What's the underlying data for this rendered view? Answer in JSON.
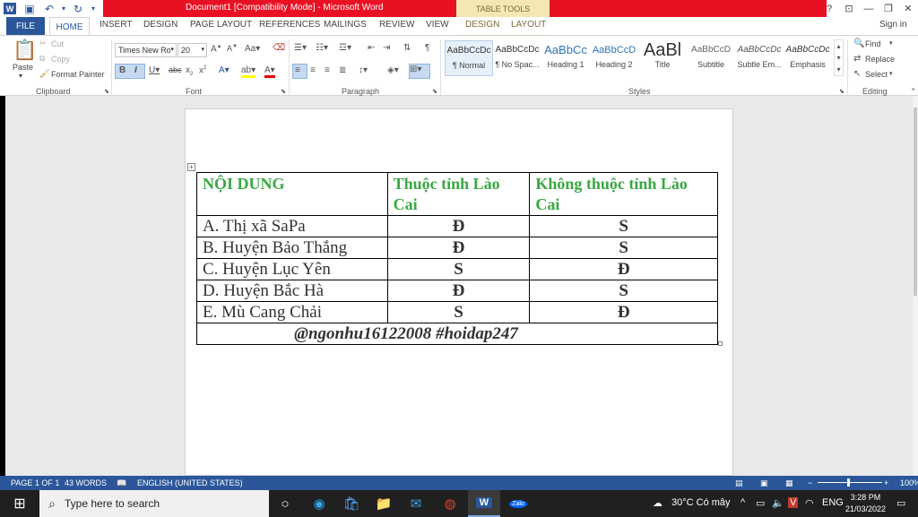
{
  "titlebar": {
    "title": "Document1 [Compatibility Mode] - Microsoft Word",
    "context_band": "TABLE TOOLS",
    "help": "?"
  },
  "tabs": {
    "file": "FILE",
    "home": "HOME",
    "insert": "INSERT",
    "design": "DESIGN",
    "page_layout": "PAGE LAYOUT",
    "references": "REFERENCES",
    "mailings": "MAILINGS",
    "review": "REVIEW",
    "view": "VIEW",
    "table_design": "DESIGN",
    "table_layout": "LAYOUT",
    "sign_in": "Sign in"
  },
  "ribbon": {
    "clipboard": {
      "label": "Clipboard",
      "paste": "Paste",
      "cut": "Cut",
      "copy": "Copy",
      "format_painter": "Format Painter"
    },
    "font": {
      "label": "Font",
      "family": "Times New Ro",
      "size": "20"
    },
    "paragraph": {
      "label": "Paragraph"
    },
    "styles": {
      "label": "Styles",
      "items": [
        {
          "preview": "AaBbCcDc",
          "name": "¶ Normal"
        },
        {
          "preview": "AaBbCcDc",
          "name": "¶ No Spac..."
        },
        {
          "preview": "AaBbCc",
          "name": "Heading 1"
        },
        {
          "preview": "AaBbCcD",
          "name": "Heading 2"
        },
        {
          "preview": "AaBl",
          "name": "Title"
        },
        {
          "preview": "AaBbCcD",
          "name": "Subtitle"
        },
        {
          "preview": "AaBbCcDc",
          "name": "Subtle Em..."
        },
        {
          "preview": "AaBbCcDc",
          "name": "Emphasis"
        }
      ]
    },
    "editing": {
      "label": "Editing",
      "find": "Find",
      "replace": "Replace",
      "select": "Select"
    }
  },
  "document": {
    "table": {
      "headers": [
        "NỘI DUNG",
        "Thuộc tỉnh Lào Cai",
        "Không thuộc tỉnh Lào Cai"
      ],
      "rows": [
        [
          "A. Thị xã SaPa",
          "Đ",
          "S"
        ],
        [
          "B. Huyện Bảo Thắng",
          "Đ",
          "S"
        ],
        [
          "C. Huyện Lục Yên",
          "S",
          "Đ"
        ],
        [
          "D. Huyện Bắc Hà",
          "Đ",
          "S"
        ],
        [
          "E. Mù Cang Chải",
          "S",
          "Đ"
        ]
      ],
      "footer": "@ngonhu16122008   #hoidap247"
    }
  },
  "statusbar": {
    "page": "PAGE 1 OF 1",
    "words": "43 WORDS",
    "language": "ENGLISH (UNITED STATES)",
    "zoom": "100%"
  },
  "taskbar": {
    "search_placeholder": "Type here to search",
    "weather": "30°C  Có mây",
    "lang": "ENG",
    "time": "3:28 PM",
    "date": "21/03/2022"
  },
  "colors": {
    "accent": "#2b579a",
    "title_red": "#e81123",
    "header_green": "#3aa843"
  }
}
